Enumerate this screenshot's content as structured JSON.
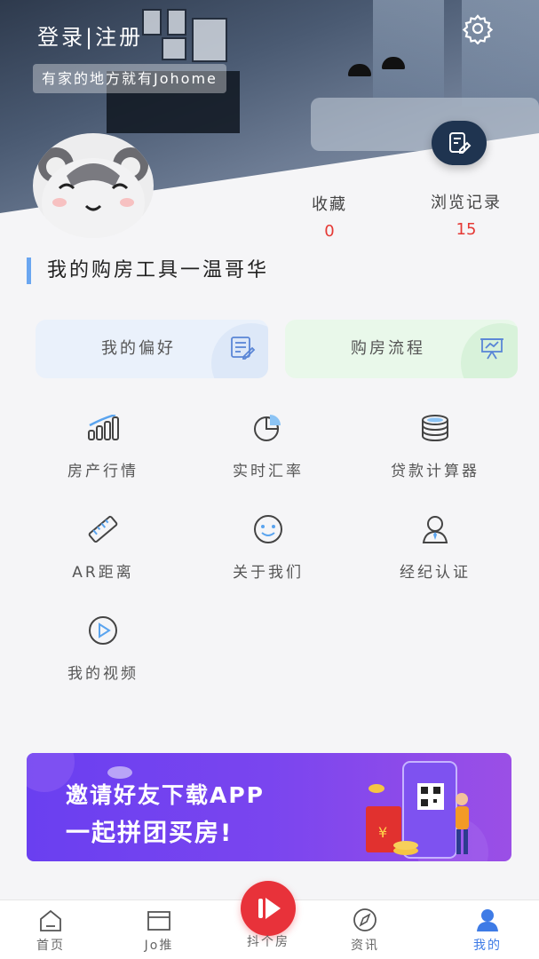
{
  "header": {
    "login_label": "登录|注册",
    "slogan": "有家的地方就有Johome"
  },
  "stats": [
    {
      "label": "收藏",
      "value": "0"
    },
    {
      "label": "浏览记录",
      "value": "15"
    }
  ],
  "section": {
    "title": "我的购房工具一温哥华"
  },
  "cards": [
    {
      "label": "我的偏好",
      "icon": "checklist-icon"
    },
    {
      "label": "购房流程",
      "icon": "presentation-icon"
    }
  ],
  "tools": [
    {
      "label": "房产行情",
      "icon": "signal-bars-icon"
    },
    {
      "label": "实时汇率",
      "icon": "pie-chart-icon"
    },
    {
      "label": "贷款计算器",
      "icon": "coin-stack-icon"
    },
    {
      "label": "AR距离",
      "icon": "ruler-icon"
    },
    {
      "label": "关于我们",
      "icon": "smiley-icon"
    },
    {
      "label": "经纪认证",
      "icon": "person-icon"
    },
    {
      "label": "我的视频",
      "icon": "play-circle-icon"
    }
  ],
  "banner": {
    "line1": "邀请好友下载APP",
    "line2": "一起拼团买房!"
  },
  "tabbar": {
    "items": [
      {
        "label": "首页",
        "icon": "home-icon"
      },
      {
        "label": "Jo推",
        "icon": "box-icon"
      },
      {
        "label": "抖个房",
        "icon": "play-icon"
      },
      {
        "label": "资讯",
        "icon": "compass-icon"
      },
      {
        "label": "我的",
        "icon": "user-icon"
      }
    ],
    "active": "我的"
  },
  "colors": {
    "accent": "#3e7be6",
    "stat_value": "#e53935",
    "play_button": "#e8323a",
    "section_bar": "#6aa6f0"
  }
}
